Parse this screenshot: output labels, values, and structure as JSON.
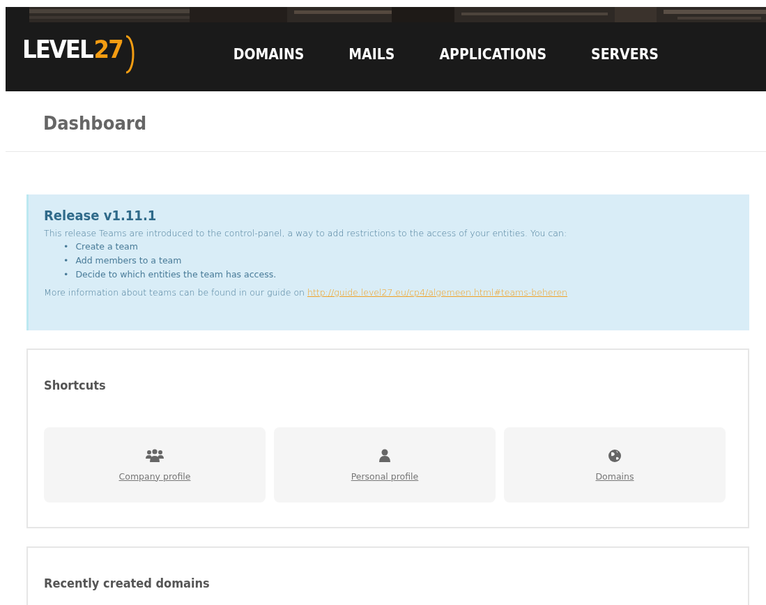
{
  "header": {
    "logo": {
      "word": "LEVEL",
      "number": "27"
    },
    "nav": [
      {
        "label": "DOMAINS"
      },
      {
        "label": "MAILS"
      },
      {
        "label": "APPLICATIONS"
      },
      {
        "label": "SERVERS"
      }
    ]
  },
  "page_title": "Dashboard",
  "alert": {
    "title": "Release v1.11.1",
    "intro": "This release Teams are introduced to the control-panel, a way to add restrictions to the access of your entities. You can:",
    "bullet": "•",
    "items": [
      "Create a team",
      "Add members to a team",
      "Decide to which entities the team has access."
    ],
    "footer": "More information about teams can be found in our guide on",
    "link": "http://guide.level27.eu/cp4/algemeen.html#teams-beheren"
  },
  "shortcuts": {
    "title": "Shortcuts",
    "items": [
      {
        "kind": "group",
        "label": "Company profile"
      },
      {
        "kind": "user",
        "label": "Personal profile"
      },
      {
        "kind": "globe",
        "label": "Domains"
      }
    ]
  },
  "recent_domains": {
    "title": "Recently created domains"
  }
}
